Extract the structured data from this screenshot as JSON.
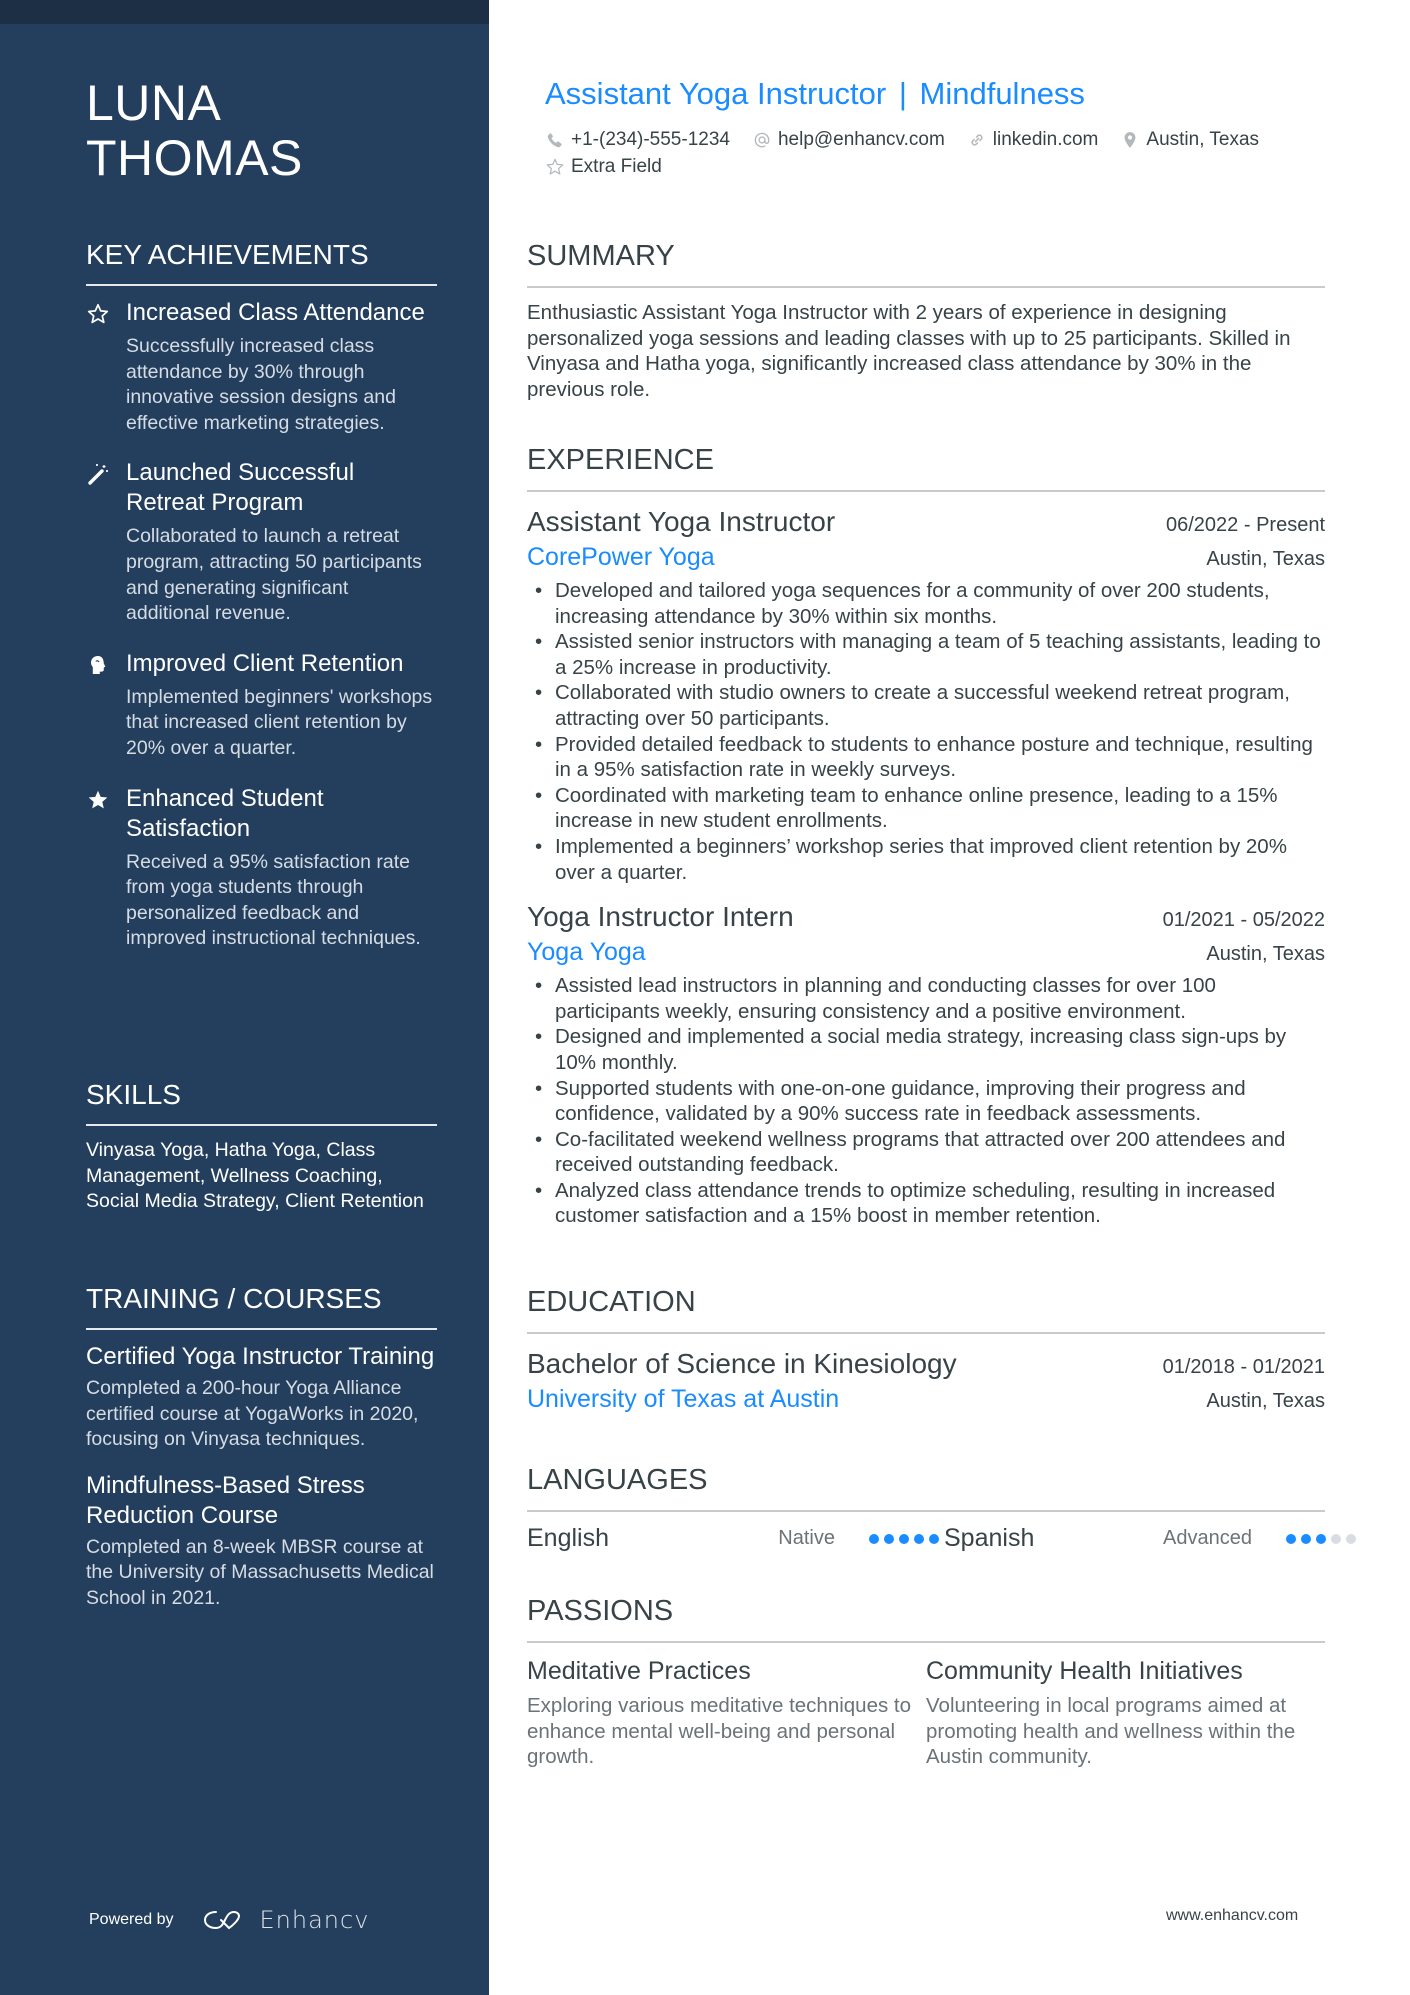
{
  "person": {
    "name_line1": "LUNA",
    "name_line2": "THOMAS",
    "headline_role": "Assistant Yoga Instructor",
    "headline_separator": "|",
    "headline_focus": "Mindfulness"
  },
  "contacts": [
    {
      "icon": "phone-icon",
      "text": "+1-(234)-555-1234"
    },
    {
      "icon": "at-icon",
      "text": "help@enhancv.com"
    },
    {
      "icon": "link-icon",
      "text": "linkedin.com"
    },
    {
      "icon": "location-pin-icon",
      "text": "Austin, Texas"
    },
    {
      "icon": "star-outline-icon",
      "text": "Extra Field"
    }
  ],
  "sidebar": {
    "achievements_title": "KEY ACHIEVEMENTS",
    "achievements": [
      {
        "icon": "star-outline-icon",
        "title": "Increased Class Attendance",
        "desc": "Successfully increased class attendance by 30% through innovative session designs and effective marketing strategies."
      },
      {
        "icon": "magic-wand-icon",
        "title": "Launched Successful Retreat Program",
        "desc": "Collaborated to launch a retreat program, attracting 50 participants and generating significant additional revenue."
      },
      {
        "icon": "head-brain-icon",
        "title": "Improved Client Retention",
        "desc": "Implemented beginners' workshops that increased client retention by 20% over a quarter."
      },
      {
        "icon": "star-filled-icon",
        "title": "Enhanced Student Satisfaction",
        "desc": "Received a 95% satisfaction rate from yoga students through personalized feedback and improved instructional techniques."
      }
    ],
    "skills_title": "SKILLS",
    "skills_text": "Vinyasa Yoga, Hatha Yoga, Class Management, Wellness Coaching, Social Media Strategy, Client Retention",
    "training_title": "TRAINING / COURSES",
    "courses": [
      {
        "title": "Certified Yoga Instructor Training",
        "desc": "Completed a 200-hour Yoga Alliance certified course at YogaWorks in 2020, focusing on Vinyasa techniques."
      },
      {
        "title": "Mindfulness-Based Stress Reduction Course",
        "desc": "Completed an 8-week MBSR course at the University of Massachusetts Medical School in 2021."
      }
    ],
    "powered_by": "Powered by",
    "brand": "Enhancv"
  },
  "summary": {
    "title": "SUMMARY",
    "text": "Enthusiastic Assistant Yoga Instructor with 2 years of experience in designing personalized yoga sessions and leading classes with up to 25 participants. Skilled in Vinyasa and Hatha yoga, significantly increased class attendance by 30% in the previous role."
  },
  "experience": {
    "title": "EXPERIENCE",
    "jobs": [
      {
        "title": "Assistant Yoga Instructor",
        "dates": "06/2022 - Present",
        "company": "CorePower Yoga",
        "location": "Austin, Texas",
        "bullets": [
          "Developed and tailored yoga sequences for a community of over 200 students, increasing attendance by 30% within six months.",
          "Assisted senior instructors with managing a team of 5 teaching assistants, leading to a 25% increase in productivity.",
          "Collaborated with studio owners to create a successful weekend retreat program, attracting over 50 participants.",
          "Provided detailed feedback to students to enhance posture and technique, resulting in a 95% satisfaction rate in weekly surveys.",
          "Coordinated with marketing team to enhance online presence, leading to a 15% increase in new student enrollments.",
          "Implemented a beginners’ workshop series that improved client retention by 20% over a quarter."
        ]
      },
      {
        "title": "Yoga Instructor Intern",
        "dates": "01/2021 - 05/2022",
        "company": "Yoga Yoga",
        "location": "Austin, Texas",
        "bullets": [
          "Assisted lead instructors in planning and conducting classes for over 100 participants weekly, ensuring consistency and a positive environment.",
          "Designed and implemented a social media strategy, increasing class sign-ups by 10% monthly.",
          "Supported students with one-on-one guidance, improving their progress and confidence, validated by a 90% success rate in feedback assessments.",
          "Co-facilitated weekend wellness programs that attracted over 200 attendees and received outstanding feedback.",
          "Analyzed class attendance trends to optimize scheduling, resulting in increased customer satisfaction and a 15% boost in member retention."
        ]
      }
    ]
  },
  "education": {
    "title": "EDUCATION",
    "degree": "Bachelor of Science in Kinesiology",
    "dates": "01/2018 - 01/2021",
    "school": "University of Texas at Austin",
    "location": "Austin, Texas"
  },
  "languages": {
    "title": "LANGUAGES",
    "items": [
      {
        "name": "English",
        "level": "Native",
        "rating": 5,
        "max": 5
      },
      {
        "name": "Spanish",
        "level": "Advanced",
        "rating": 3,
        "max": 5
      }
    ]
  },
  "passions": {
    "title": "PASSIONS",
    "items": [
      {
        "title": "Meditative Practices",
        "desc": "Exploring various meditative techniques to enhance mental well-being and personal growth."
      },
      {
        "title": "Community Health Initiatives",
        "desc": "Volunteering in local programs aimed at promoting health and wellness within the Austin community."
      }
    ]
  },
  "footer": {
    "url": "www.enhancv.com"
  },
  "colors": {
    "sidebar_bg": "#243f5d",
    "accent": "#1a8cff",
    "text": "#384347"
  }
}
